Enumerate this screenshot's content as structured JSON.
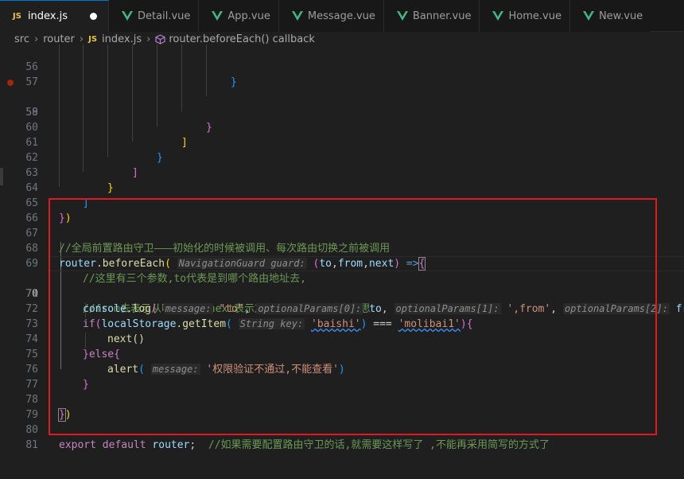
{
  "tabs": [
    {
      "label": "index.js",
      "icon": "js-icon",
      "active": true,
      "modified": true
    },
    {
      "label": "Detail.vue",
      "icon": "vue-icon"
    },
    {
      "label": "App.vue",
      "icon": "vue-icon"
    },
    {
      "label": "Message.vue",
      "icon": "vue-icon"
    },
    {
      "label": "Banner.vue",
      "icon": "vue-icon"
    },
    {
      "label": "Home.vue",
      "icon": "vue-icon"
    },
    {
      "label": "New.vue",
      "icon": "vue-icon"
    }
  ],
  "tab_icon_js": "JS",
  "breadcrumb": {
    "src": "src",
    "router": "router",
    "file_icon": "JS",
    "file": "index.js",
    "symbol": "router.beforeEach() callback"
  },
  "line_numbers": [
    "56",
    "57",
    "58",
    "59",
    "60",
    "61",
    "62",
    "63",
    "64",
    "65",
    "66",
    "67",
    "68",
    "69",
    "70",
    "71",
    "72",
    "73",
    "74",
    "75",
    "76",
    "77",
    "78",
    "79",
    "80",
    "81"
  ],
  "current_line": "70",
  "code": {
    "l56": "}",
    "l59": "}",
    "l60": "]",
    "l61": "}",
    "l62": "]",
    "l63": "}",
    "l64": "]",
    "l65a": "}",
    "l65b": ")",
    "l67": "//全局前置路由守卫———初始化的时候被调用、每次路由切换之前被调用",
    "l68_obj": "router",
    "l68_dot": ".",
    "l68_fn": "beforeEach",
    "l68_p1": "(",
    "l68_hint": "NavigationGuard guard:",
    "l68_p2": "(",
    "l68_to": "to",
    "l68_c1": ",",
    "l68_from": "from",
    "l68_c2": ",",
    "l68_next": "next",
    "l68_p3": ")",
    "l68_arrow": " =>",
    "l68_brace": "{",
    "l69": "//这里有三个参数,to代表是到哪个路由地址去,",
    "l70": "//from去表示从哪里来的,next表示放行,下一步,继续的意思",
    "l71_obj": "console",
    "l71_dot": ".",
    "l71_fn": "log",
    "l71_p": "(",
    "l71_h1": "message:",
    "l71_s1": "\"to\"",
    "l71_c1": ",",
    "l71_h2": "optionalParams[0]:",
    "l71_to": "to",
    "l71_c2": ",",
    "l71_h3": "optionalParams[1]:",
    "l71_s2": "',from'",
    "l71_c3": ",",
    "l71_h4": "optionalParams[2]:",
    "l71_from": "from",
    "l71_end": ");",
    "l72_if": "if",
    "l72_p": "(",
    "l72_obj": "localStorage",
    "l72_dot": ".",
    "l72_fn": "getItem",
    "l72_p2": "(",
    "l72_hint": "String key:",
    "l72_s1": "'baishi'",
    "l72_p3": ")",
    "l72_op": " === ",
    "l72_s2": "'molibai1'",
    "l72_p4": ")",
    "l72_brace": "{",
    "l73": "next()",
    "l74_b1": "}",
    "l74_else": "else",
    "l74_b2": "{",
    "l75_fn": "alert",
    "l75_p": "(",
    "l75_hint": "message:",
    "l75_str": "'权限验证不通过,不能查看'",
    "l75_p2": ")",
    "l76": "}",
    "l79a": "}",
    "l79b": ")",
    "l80_export": "export",
    "l80_default": "default",
    "l80_router": "router",
    "l80_semi": ";",
    "l80_comment": "//如果需要配置路由守卫的话,就需要这样写了 ,不能再采用简写的方式了"
  },
  "colors": {
    "comment": "#6a9955",
    "variable": "#9cdcfe",
    "function": "#dcdcaa",
    "keyword": "#c586c0",
    "string": "#ce9178",
    "highlight_box": "#e0191f"
  }
}
